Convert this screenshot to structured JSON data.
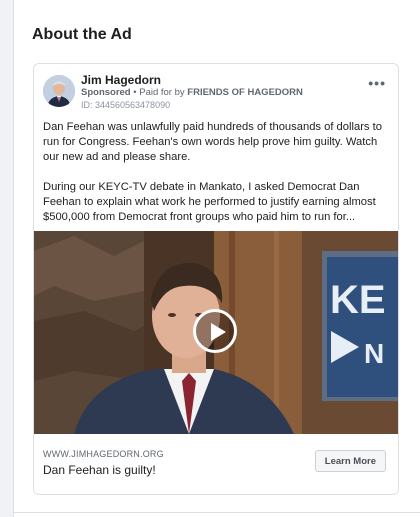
{
  "section": {
    "title": "About the Ad"
  },
  "ad": {
    "advertiser_name": "Jim Hagedorn",
    "sponsored_label": "Sponsored",
    "paid_for_prefix": " • Paid for by ",
    "paid_for_by": "FRIENDS OF HAGEDORN",
    "ad_id": "ID: 344560563478090",
    "more_label": "•••",
    "body": {
      "paragraph_1": "Dan Feehan was unlawfully paid hundreds of thousands of dollars to run for Congress. Feehan's own words help prove him guilty. Watch our new ad and please share.",
      "paragraph_2": "During our KEYC-TV debate in Mankato, I asked Democrat Dan Feehan to explain what work he performed to justify earning almost $500,000 from Democrat front groups who paid him to run for..."
    },
    "video": {
      "background_sign": "KEYC",
      "icon": "play-icon"
    },
    "link": {
      "url": "WWW.JIMHAGEDORN.ORG",
      "headline": "Dan Feehan is guilty!",
      "cta_label": "Learn More"
    }
  },
  "colors": {
    "text_primary": "#1c1e21",
    "text_secondary": "#606770",
    "border": "#dddfe2",
    "page_bg": "#f0f2f5"
  }
}
